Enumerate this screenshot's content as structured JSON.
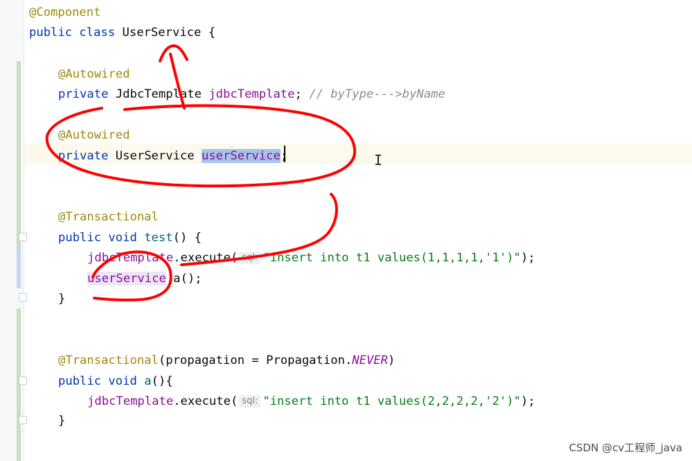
{
  "editor": {
    "line_component": "@Component",
    "line_class": {
      "kw": "public class ",
      "name": "UserService",
      "rest": " {"
    },
    "line_autowired_1": "@Autowired",
    "line_field_1": {
      "kw": "private ",
      "type": "JdbcTemplate ",
      "name": "jdbcTemplate",
      "semi": "; ",
      "comment": "// byType--->byName"
    },
    "line_autowired_2": "@Autowired",
    "line_field_2": {
      "kw": "private ",
      "type": "UserService ",
      "name": "userService",
      "semi": ";"
    },
    "line_transactional_1": "@Transactional",
    "line_method_test": {
      "kw": "public void ",
      "name": "test",
      "rest": "() {"
    },
    "line_execute_1": {
      "obj": "jdbcTemplate",
      "call": ".execute(",
      "hint": "sql:",
      "arg": "\"insert into t1 values(1,1,1,1,'1')\"",
      "end": ");"
    },
    "line_call_a": {
      "obj": "userService",
      "call": ".a();"
    },
    "line_close_1": "}",
    "line_transactional_2": {
      "ann": "@Transactional",
      "mid": "(propagation = Propagation.",
      "const": "NEVER",
      "end": ")"
    },
    "line_method_a": {
      "kw": "public void ",
      "name": "a",
      "rest": "(){"
    },
    "line_execute_2": {
      "obj": "jdbcTemplate",
      "call": ".execute(",
      "hint": "sql:",
      "arg": "\"insert into t1 values(2,2,2,2,'2')\"",
      "end": ");"
    },
    "line_close_2": "}"
  },
  "watermark": "CSDN @cv工程师_java",
  "colors": {
    "annotation_marker": "#ff0000",
    "selection": "#a6c4ea",
    "caret_line": "#fcfaed"
  },
  "icons": {
    "text_cursor": "I"
  }
}
